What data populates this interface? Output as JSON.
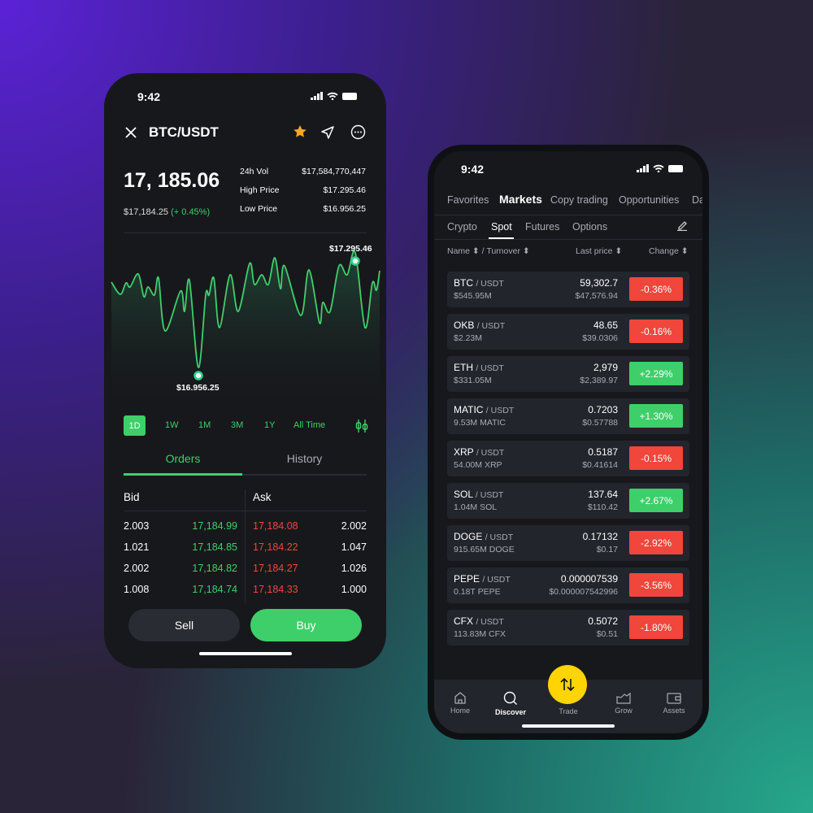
{
  "colors": {
    "up": "#3ecf6a",
    "down": "#f0463c",
    "accent_yellow": "#ffd400",
    "star": "#f5a623"
  },
  "left": {
    "status_time": "9:42",
    "pair": "BTC/USDT",
    "price": "17, 185.06",
    "sub_price": "$17,184.25",
    "sub_change": "(+ 0.45%)",
    "stats": [
      {
        "label": "24h Vol",
        "value": "$17,584,770,447"
      },
      {
        "label": "High Price",
        "value": "$17.295.46"
      },
      {
        "label": "Low Price",
        "value": "$16.956.25"
      }
    ],
    "chart": {
      "high_label": "$17.295.46",
      "low_label": "$16.956.25"
    },
    "timeframes": [
      "1D",
      "1W",
      "1M",
      "3M",
      "1Y",
      "All Time"
    ],
    "active_timeframe": "1D",
    "tabs": [
      "Orders",
      "History"
    ],
    "active_tab": "Orders",
    "bid_label": "Bid",
    "ask_label": "Ask",
    "orders": [
      {
        "bid_qty": "2.003",
        "bid": "17,184.99",
        "ask": "17,184.08",
        "ask_qty": "2.002"
      },
      {
        "bid_qty": "1.021",
        "bid": "17,184.85",
        "ask": "17,184.22",
        "ask_qty": "1.047"
      },
      {
        "bid_qty": "2.002",
        "bid": "17,184.82",
        "ask": "17,184.27",
        "ask_qty": "1.026"
      },
      {
        "bid_qty": "1.008",
        "bid": "17,184.74",
        "ask": "17,184.33",
        "ask_qty": "1.000"
      }
    ],
    "sell": "Sell",
    "buy": "Buy"
  },
  "right": {
    "status_time": "9:42",
    "top_tabs": [
      "Favorites",
      "Markets",
      "Copy trading",
      "Opportunities",
      "Da"
    ],
    "active_top_tab": "Markets",
    "sub_tabs": [
      "Crypto",
      "Spot",
      "Futures",
      "Options"
    ],
    "active_sub_tab": "Spot",
    "headers": {
      "name": "Name",
      "sep": "/",
      "turnover": "Turnover",
      "last_price": "Last price",
      "change": "Change"
    },
    "markets": [
      {
        "base": "BTC",
        "quote": "/ USDT",
        "turnover": "$545.95M",
        "price": "59,302.7",
        "usd": "$47,576.94",
        "change": "-0.36%",
        "dir": "down"
      },
      {
        "base": "OKB",
        "quote": "/ USDT",
        "turnover": "$2.23M",
        "price": "48.65",
        "usd": "$39.0306",
        "change": "-0.16%",
        "dir": "down"
      },
      {
        "base": "ETH",
        "quote": "/ USDT",
        "turnover": "$331.05M",
        "price": "2,979",
        "usd": "$2,389.97",
        "change": "+2.29%",
        "dir": "up"
      },
      {
        "base": "MATIC",
        "quote": "/ USDT",
        "turnover": "9.53M MATIC",
        "price": "0.7203",
        "usd": "$0.57788",
        "change": "+1.30%",
        "dir": "up"
      },
      {
        "base": "XRP",
        "quote": "/ USDT",
        "turnover": "54.00M XRP",
        "price": "0.5187",
        "usd": "$0.41614",
        "change": "-0.15%",
        "dir": "down"
      },
      {
        "base": "SOL",
        "quote": "/ USDT",
        "turnover": "1.04M SOL",
        "price": "137.64",
        "usd": "$110.42",
        "change": "+2.67%",
        "dir": "up"
      },
      {
        "base": "DOGE",
        "quote": "/ USDT",
        "turnover": "915.65M DOGE",
        "price": "0.17132",
        "usd": "$0.17",
        "change": "-2.92%",
        "dir": "down"
      },
      {
        "base": "PEPE",
        "quote": "/ USDT",
        "turnover": "0.18T PEPE",
        "price": "0.000007539",
        "usd": "$0.000007542996",
        "change": "-3.56%",
        "dir": "down"
      },
      {
        "base": "CFX",
        "quote": "/ USDT",
        "turnover": "113.83M CFX",
        "price": "0.5072",
        "usd": "$0.51",
        "change": "-1.80%",
        "dir": "down"
      }
    ],
    "nav": [
      {
        "label": "Home",
        "icon": "home-icon"
      },
      {
        "label": "Discover",
        "icon": "search-icon"
      },
      {
        "label": "Trade",
        "icon": "swap-icon"
      },
      {
        "label": "Grow",
        "icon": "chart-icon"
      },
      {
        "label": "Assets",
        "icon": "wallet-icon"
      }
    ],
    "active_nav": "Discover"
  }
}
